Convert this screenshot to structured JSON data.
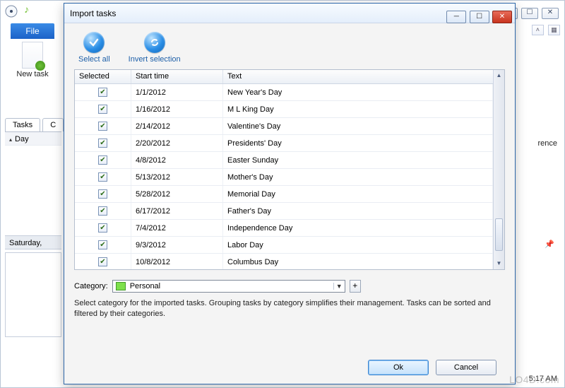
{
  "background": {
    "file_button": "File",
    "new_task_label": "New task",
    "tabs": [
      "Tasks",
      "C"
    ],
    "day_label": "Day",
    "saturday_label": "Saturday,",
    "right_stub": "rence",
    "time_stub": "5:17 AM"
  },
  "dialog": {
    "title": "Import tasks",
    "actions": {
      "select_all": "Select all",
      "invert": "Invert selection"
    },
    "columns": {
      "selected": "Selected",
      "start": "Start time",
      "text": "Text"
    },
    "rows": [
      {
        "checked": true,
        "start": "1/1/2012",
        "text": "New Year's Day"
      },
      {
        "checked": true,
        "start": "1/16/2012",
        "text": "M L King Day"
      },
      {
        "checked": true,
        "start": "2/14/2012",
        "text": "Valentine's Day"
      },
      {
        "checked": true,
        "start": "2/20/2012",
        "text": "Presidents' Day"
      },
      {
        "checked": true,
        "start": "4/8/2012",
        "text": "Easter Sunday"
      },
      {
        "checked": true,
        "start": "5/13/2012",
        "text": "Mother's Day"
      },
      {
        "checked": true,
        "start": "5/28/2012",
        "text": "Memorial Day"
      },
      {
        "checked": true,
        "start": "6/17/2012",
        "text": "Father's Day"
      },
      {
        "checked": true,
        "start": "7/4/2012",
        "text": "Independence Day"
      },
      {
        "checked": true,
        "start": "9/3/2012",
        "text": "Labor Day"
      },
      {
        "checked": true,
        "start": "10/8/2012",
        "text": "Columbus Day"
      }
    ],
    "category": {
      "label": "Category:",
      "value": "Personal",
      "swatch": "#7de04b"
    },
    "help": "Select category for the imported tasks. Grouping tasks by category simplifies their management. Tasks can be sorted and filtered by their categories.",
    "buttons": {
      "ok": "Ok",
      "cancel": "Cancel"
    }
  },
  "watermark": "LO4D.com"
}
